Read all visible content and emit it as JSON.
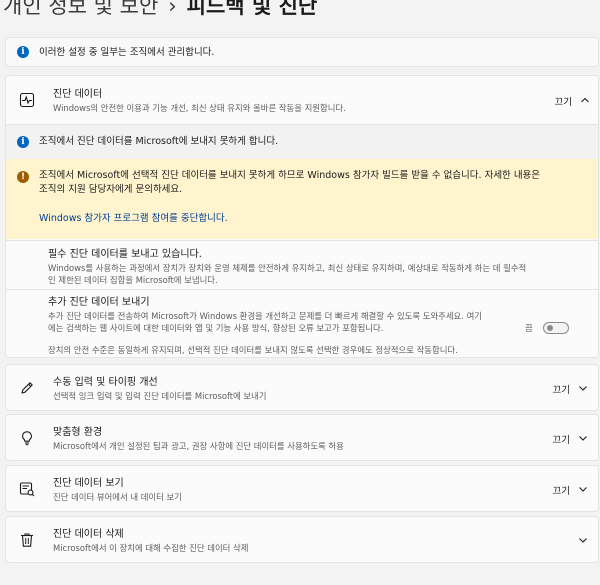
{
  "breadcrumb": {
    "parent": "개인 정보 및 보안",
    "separator": "›",
    "current": "피드백 및 진단"
  },
  "org_notice": "이러한 설정 중 일부는 조직에서 관리합니다.",
  "diagnostic_data": {
    "title": "진단 데이터",
    "description": "Windows의 안전한 이용과 기능 개선, 최신 상태 유지와 올바른 작동을 지원합니다.",
    "state": "끄기",
    "policy_notice": "조직에서 진단 데이터를 Microsoft에 보내지 못하게 합니다.",
    "warning_line1": "조직에서 Microsoft에 선택적 진단 데이터를 보내지 못하게 하므로 Windows 참가자 빌드를 받을 수 없습니다. 자세한 내용은",
    "warning_line2": "조직의 지원 담당자에게 문의하세요.",
    "warning_link": "Windows 참가자 프로그램 참여를 중단합니다.",
    "required": {
      "title": "필수 진단 데이터를 보내고 있습니다.",
      "desc_line1": "Windows를 사용하는 과정에서 장치가 장치와 운영 체제를 안전하게 유지하고, 최신 상태로 유지하며, 예상대로 작동하게 하는 데 필수적",
      "desc_line2": "인 제한된 데이터 집합을 Microsoft에 보냅니다."
    },
    "optional": {
      "title": "추가 진단 데이터 보내기",
      "desc_line1": "추가 진단 데이터를 전송하여 Microsoft가 Windows 환경을 개선하고 문제를 더 빠르게 해결할 수 있도록 도와주세요. 여기",
      "desc_line2": "에는 검색하는 웹 사이트에 대한 데이터와 앱 및 기능 사용 방식, 향상된 오류 보고가 포함됩니다.",
      "toggle_label": "끔"
    },
    "footer_note": "장치의 안전 수준은 동일하게 유지되며, 선택적 진단 데이터를 보내지 않도록 선택한 경우에도 정상적으로 작동합니다."
  },
  "rows": [
    {
      "title": "수동 입력 및 타이핑 개선",
      "description": "선택적 잉크 입력 및 입력 진단 데이터를 Microsoft에 보내기",
      "state": "끄기"
    },
    {
      "title": "맞춤형 환경",
      "description": "Microsoft에서 개인 설정된 팁과 광고, 권장 사항에 진단 데이터를 사용하도록 허용",
      "state": "끄기"
    },
    {
      "title": "진단 데이터 보기",
      "description": "진단 데이터 뷰어에서 내 데이터 보기",
      "state": "끄기"
    },
    {
      "title": "진단 데이터 삭제",
      "description": "Microsoft에서 이 장치에 대해 수집한 진단 데이터 삭제",
      "state": ""
    }
  ],
  "icons": {
    "info": "info-icon",
    "warning": "warning-icon",
    "diagnostics": "pulse-icon",
    "inking": "pen-icon",
    "tailored": "lightbulb-icon",
    "viewer": "data-viewer-icon",
    "delete": "trash-icon"
  },
  "colors": {
    "accent": "#0067c0",
    "warning_bg": "#fff4ce",
    "info_bg": "#f2f2f2"
  }
}
